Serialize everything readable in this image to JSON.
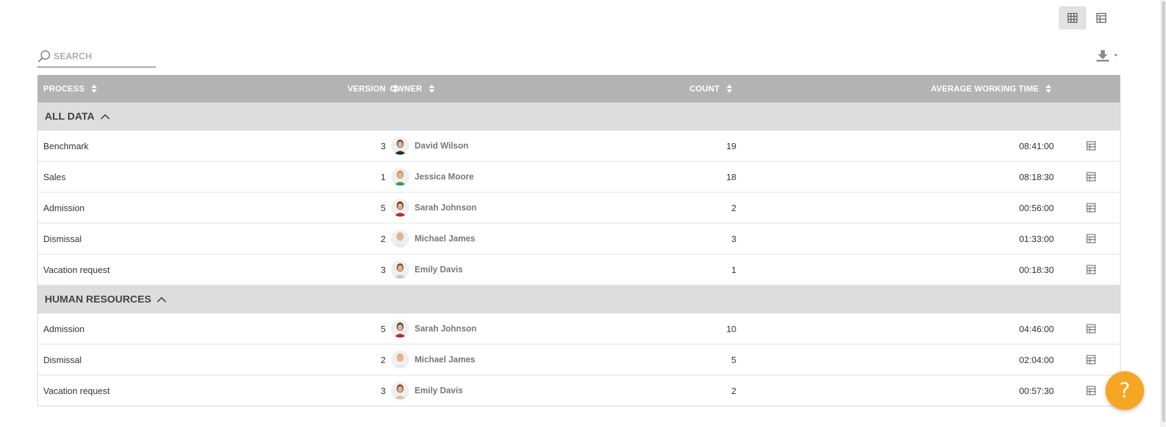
{
  "toolbar": {
    "views": [
      {
        "icon": "grid-view-icon",
        "active": true
      },
      {
        "icon": "table-view-icon",
        "active": false
      }
    ],
    "download_icon": "download-icon"
  },
  "search": {
    "placeholder": "SEARCH",
    "value": "",
    "icon": "search-icon"
  },
  "table": {
    "columns": {
      "process": "PROCESS",
      "version": "VERSION",
      "owner": "OWNER",
      "count": "COUNT",
      "avg": "AVERAGE WORKING TIME"
    },
    "groups": [
      {
        "label": "ALL DATA",
        "expanded": true,
        "rows": [
          {
            "process": "Benchmark",
            "version": "3",
            "owner": "David Wilson",
            "count": "19",
            "avg": "08:41:00"
          },
          {
            "process": "Sales",
            "version": "1",
            "owner": "Jessica Moore",
            "count": "18",
            "avg": "08:18:30"
          },
          {
            "process": "Admission",
            "version": "5",
            "owner": "Sarah Johnson",
            "count": "2",
            "avg": "00:56:00"
          },
          {
            "process": "Dismissal",
            "version": "2",
            "owner": "Michael James",
            "count": "3",
            "avg": "01:33:00"
          },
          {
            "process": "Vacation request",
            "version": "3",
            "owner": "Emily Davis",
            "count": "1",
            "avg": "00:18:30"
          }
        ]
      },
      {
        "label": "HUMAN RESOURCES",
        "expanded": true,
        "rows": [
          {
            "process": "Admission",
            "version": "5",
            "owner": "Sarah Johnson",
            "count": "10",
            "avg": "04:46:00"
          },
          {
            "process": "Dismissal",
            "version": "2",
            "owner": "Michael James",
            "count": "5",
            "avg": "02:04:00"
          },
          {
            "process": "Vacation request",
            "version": "3",
            "owner": "Emily Davis",
            "count": "2",
            "avg": "00:57:30"
          }
        ]
      }
    ]
  },
  "help": {
    "label": "?"
  },
  "colors": {
    "header_bg": "#b3b3b3",
    "group_bg": "#dddddd",
    "help_bg": "#f5a623"
  }
}
